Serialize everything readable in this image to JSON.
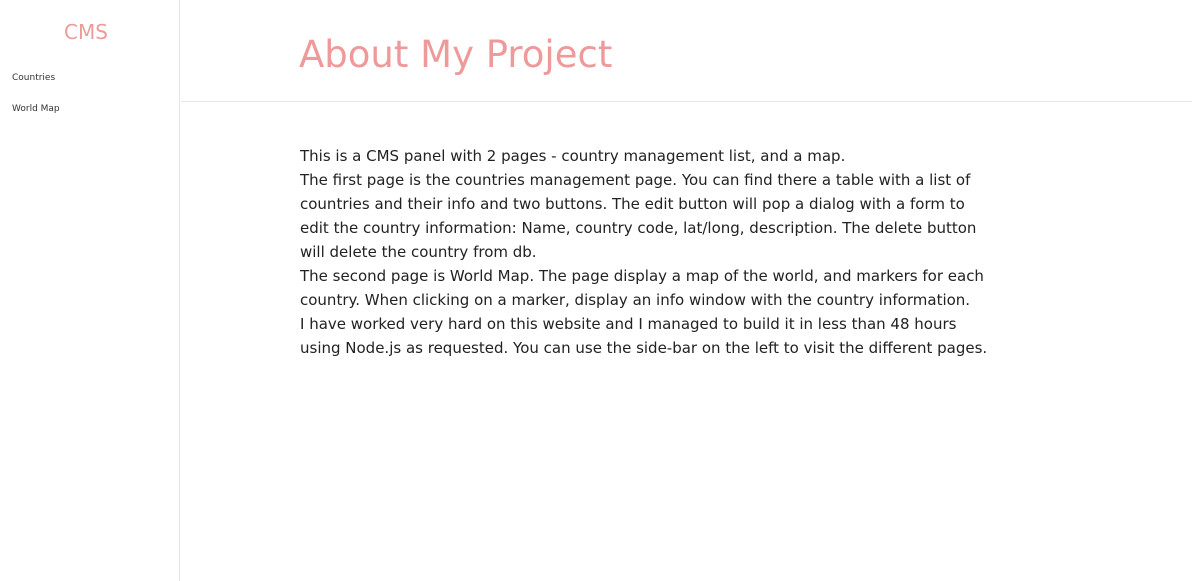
{
  "sidebar": {
    "brand": "CMS",
    "items": [
      {
        "label": "Countries"
      },
      {
        "label": "World Map"
      }
    ]
  },
  "header": {
    "title": "About My Project"
  },
  "content": {
    "paragraphs": [
      "This is a CMS panel with 2 pages - country management list, and a map.",
      "The first page is the countries management page. You can find there a table with a list of countries and their info and two buttons. The edit button will pop a dialog with a form to edit the country information: Name, country code, lat/long, description. The delete button will delete the country from db.",
      "The second page is World Map. The page display a map of the world, and markers for each country. When clicking on a marker, display an info window with the country information.",
      "I have worked very hard on this website and I managed to build it in less than 48 hours using Node.js as requested. You can use the side-bar on the left to visit the different pages."
    ]
  },
  "colors": {
    "accent": "#ef9a9a",
    "border": "#e6e6e6",
    "text": "#222222"
  }
}
